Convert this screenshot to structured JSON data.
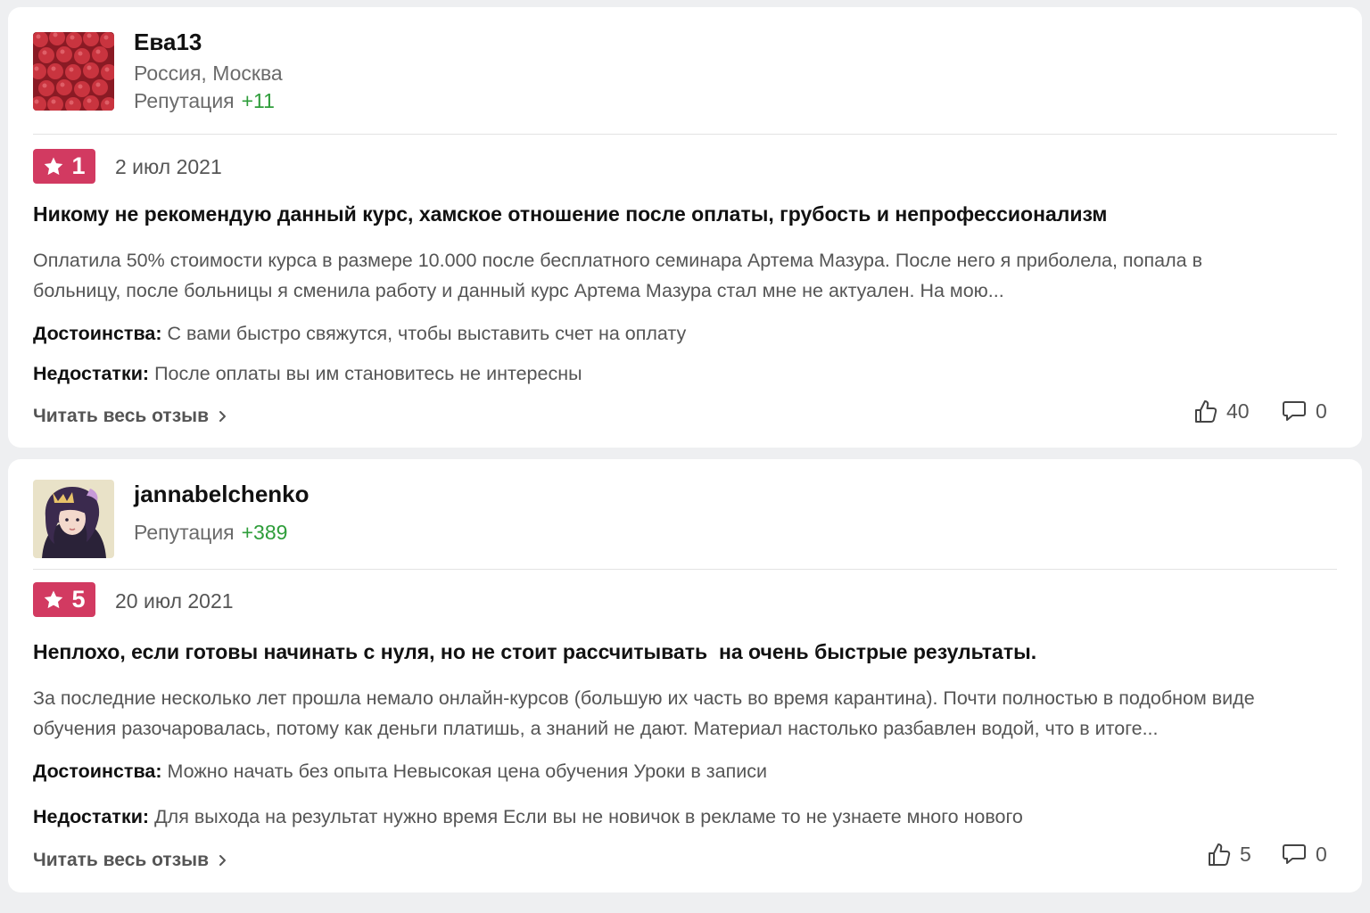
{
  "reviews": [
    {
      "user": {
        "name": "Ева13",
        "location": "Россия, Москва",
        "reputation_label": "Репутация",
        "reputation_value": "+11",
        "avatar_icon": "raspberries-photo"
      },
      "rating": "1",
      "date": "2 июл 2021",
      "title": "Никому не рекомендую данный курс, хамское отношение после оплаты, грубость и непрофессионализм",
      "excerpt": "Оплатила 50% стоимости курса в размере 10.000 после бесплатного семинара Артема Мазура. После него я приболела, попала в больницу, после больницы я сменила работу и данный курс Артема Мазура стал мне не актуален. На мою...",
      "pros_label": "Достоинства:",
      "pros": "С вами быстро свяжутся, чтобы выставить счет на оплату",
      "cons_label": "Недостатки:",
      "cons": "После оплаты вы им становитесь не интересны",
      "read_more": "Читать весь отзыв",
      "likes": "40",
      "comments": "0"
    },
    {
      "user": {
        "name": "jannabelchenko",
        "reputation_label": "Репутация",
        "reputation_value": "+389",
        "avatar_icon": "girl-illustration"
      },
      "rating": "5",
      "date": "20 июл 2021",
      "title": "Неплохо, если готовы начинать с нуля, но не стоит рассчитывать  на очень быстрые результаты.",
      "excerpt": "За последние несколько лет прошла немало онлайн-курсов (большую их часть во время карантина). Почти полностью в подобном виде обучения разочаровалась, потому как деньги платишь, а знаний не дают. Материал настолько разбавлен водой, что в итоге...",
      "pros_label": "Достоинства:",
      "pros": "Можно начать без опыта Невысокая цена обучения Уроки в записи",
      "cons_label": "Недостатки:",
      "cons": "Для выхода на результат нужно время Если вы не новичок в рекламе то не узнаете много нового",
      "read_more": "Читать весь отзыв",
      "likes": "5",
      "comments": "0"
    }
  ],
  "colors": {
    "badge": "#d23a61",
    "reputation": "#2e9d3a",
    "background": "#eeeff1",
    "card": "#ffffff"
  },
  "icons": {
    "star": "star-icon",
    "like": "thumbs-up-icon",
    "comment": "comment-icon",
    "read_more": "chevron-right-icon"
  }
}
